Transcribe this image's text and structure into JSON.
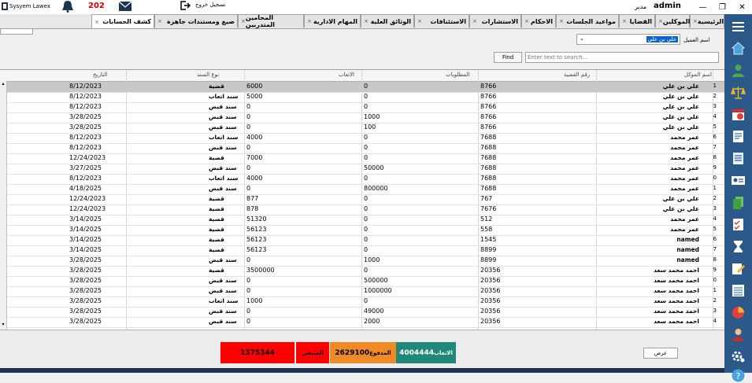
{
  "app": {
    "title": "Sysyem Lawex",
    "user": "admin",
    "role": "مدير",
    "notification_count": "202",
    "logout_label": "تسجيل خروج"
  },
  "tabs": [
    {
      "label": "الرئيسية"
    },
    {
      "label": "الموكلين"
    },
    {
      "label": "القضايا"
    },
    {
      "label": "مواعيد الجلسات"
    },
    {
      "label": "الاحكام"
    },
    {
      "label": "الاستشارات"
    },
    {
      "label": "الاستئنافات"
    },
    {
      "label": "الوثائق العلية"
    },
    {
      "label": "المهام الادارية"
    },
    {
      "label": "المحامين المتدربين"
    },
    {
      "label": "صيغ ومستندات جاهزة"
    },
    {
      "label": "كشف الحسابات"
    }
  ],
  "filters": {
    "client_label": "اسم العميل",
    "client_value": "علي بن علي",
    "search_placeholder": "Enter text to search...",
    "find_label": "Find"
  },
  "grid": {
    "columns": {
      "name": "اسم الموكل",
      "case": "رقم القضية",
      "due": "المطلوبات",
      "fees": "الاتعاب",
      "type": "نوع السند",
      "date": "التاريخ"
    },
    "rows": [
      {
        "idx": "1",
        "name": "علي بن علي",
        "case": "8766",
        "due": "0",
        "fees": "6000",
        "type": "قضية",
        "date": "8/12/2023"
      },
      {
        "idx": "2",
        "name": "علي بن علي",
        "case": "8766",
        "due": "0",
        "fees": "5000",
        "type": "سند اتعاب",
        "date": "8/12/2023"
      },
      {
        "idx": "3",
        "name": "علي بن علي",
        "case": "8766",
        "due": "0",
        "fees": "0",
        "type": "سند قبض",
        "date": "8/12/2023"
      },
      {
        "idx": "4",
        "name": "علي بن علي",
        "case": "8766",
        "due": "1000",
        "fees": "0",
        "type": "سند قبض",
        "date": "3/28/2025"
      },
      {
        "idx": "5",
        "name": "علي بن علي",
        "case": "8766",
        "due": "100",
        "fees": "0",
        "type": "سند قبض",
        "date": "3/28/2025"
      },
      {
        "idx": "6",
        "name": "عمر محمد",
        "case": "7688",
        "due": "0",
        "fees": "4000",
        "type": "سند اتعاب",
        "date": "8/12/2023"
      },
      {
        "idx": "7",
        "name": "عمر محمد",
        "case": "7688",
        "due": "0",
        "fees": "0",
        "type": "سند قبض",
        "date": "8/12/2023"
      },
      {
        "idx": "8",
        "name": "عمر محمد",
        "case": "7688",
        "due": "0",
        "fees": "7000",
        "type": "قضية",
        "date": "12/24/2023"
      },
      {
        "idx": "9",
        "name": "عمر محمد",
        "case": "7688",
        "due": "50000",
        "fees": "0",
        "type": "سند قبض",
        "date": "3/27/2025"
      },
      {
        "idx": "0",
        "name": "عمر محمد",
        "case": "7688",
        "due": "0",
        "fees": "4000",
        "type": "سند اتعاب",
        "date": "8/12/2023"
      },
      {
        "idx": "1",
        "name": "عمر محمد",
        "case": "7688",
        "due": "800000",
        "fees": "0",
        "type": "سند قبض",
        "date": "4/18/2025"
      },
      {
        "idx": "2",
        "name": "علي بن علي",
        "case": "767",
        "due": "0",
        "fees": "877",
        "type": "قضية",
        "date": "12/24/2023"
      },
      {
        "idx": "3",
        "name": "علي بن علي",
        "case": "7676",
        "due": "0",
        "fees": "878",
        "type": "قضية",
        "date": "12/24/2023"
      },
      {
        "idx": "4",
        "name": "عمر محمد",
        "case": "512",
        "due": "0",
        "fees": "51320",
        "type": "قضية",
        "date": "3/14/2025"
      },
      {
        "idx": "5",
        "name": "عمر محمد",
        "case": "558",
        "due": "0",
        "fees": "56123",
        "type": "قضية",
        "date": "3/14/2025"
      },
      {
        "idx": "6",
        "name": "named",
        "case": "1545",
        "due": "0",
        "fees": "56123",
        "type": "قضية",
        "date": "3/14/2025"
      },
      {
        "idx": "7",
        "name": "named",
        "case": "8899",
        "due": "0",
        "fees": "56123",
        "type": "قضية",
        "date": "3/14/2025"
      },
      {
        "idx": "8",
        "name": "named",
        "case": "8899",
        "due": "1000",
        "fees": "0",
        "type": "سند قبض",
        "date": "3/28/2025"
      },
      {
        "idx": "9",
        "name": "احمد محمد سعد",
        "case": "20356",
        "due": "0",
        "fees": "3500000",
        "type": "قضية",
        "date": "3/28/2025"
      },
      {
        "idx": "0",
        "name": "احمد محمد سعد",
        "case": "20356",
        "due": "500000",
        "fees": "0",
        "type": "سند قبض",
        "date": "3/28/2025"
      },
      {
        "idx": "1",
        "name": "احمد محمد سعد",
        "case": "20356",
        "due": "1000000",
        "fees": "0",
        "type": "سند قبض",
        "date": "3/28/2025"
      },
      {
        "idx": "2",
        "name": "احمد محمد سعد",
        "case": "20356",
        "due": "0",
        "fees": "1000",
        "type": "سند اتعاب",
        "date": "3/28/2025"
      },
      {
        "idx": "3",
        "name": "احمد محمد سعد",
        "case": "20356",
        "due": "49000",
        "fees": "0",
        "type": "سند قبض",
        "date": "3/28/2025"
      },
      {
        "idx": "4",
        "name": "احمد محمد سعد",
        "case": "20356",
        "due": "2000",
        "fees": "0",
        "type": "سند قبض",
        "date": "3/28/2025"
      }
    ]
  },
  "summary": {
    "remaining_value": "1375344",
    "remaining_label": "المتبقي",
    "paid_label": "المدفوع",
    "paid_value": "2629100",
    "fees_label": "الاتعاب",
    "fees_value": "4004444",
    "show_label": "عرض"
  },
  "colors": {
    "sidebar": "#2b5a8a",
    "remaining": "#ff0000",
    "paid": "#ef8b26",
    "fees": "#208878",
    "selection": "#0a64c8"
  }
}
